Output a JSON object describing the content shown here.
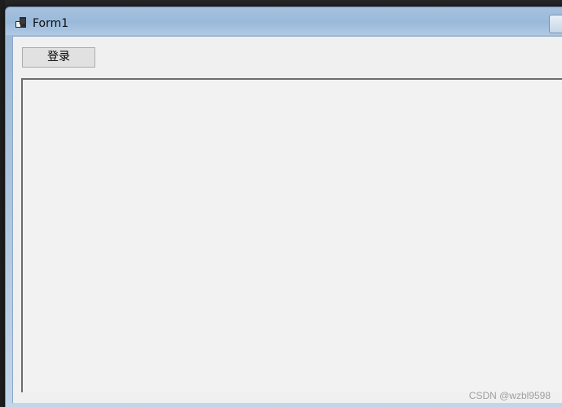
{
  "window": {
    "title": "Form1",
    "icon": "winforms-app-icon"
  },
  "form": {
    "login_button_label": "登录"
  },
  "watermark": {
    "text": "CSDN @wzbl9598"
  },
  "colors": {
    "titlebar": "#9dbad9",
    "client": "#f0f0f0",
    "panel_border": "#6d6d6d",
    "button_face": "#e1e1e1"
  }
}
